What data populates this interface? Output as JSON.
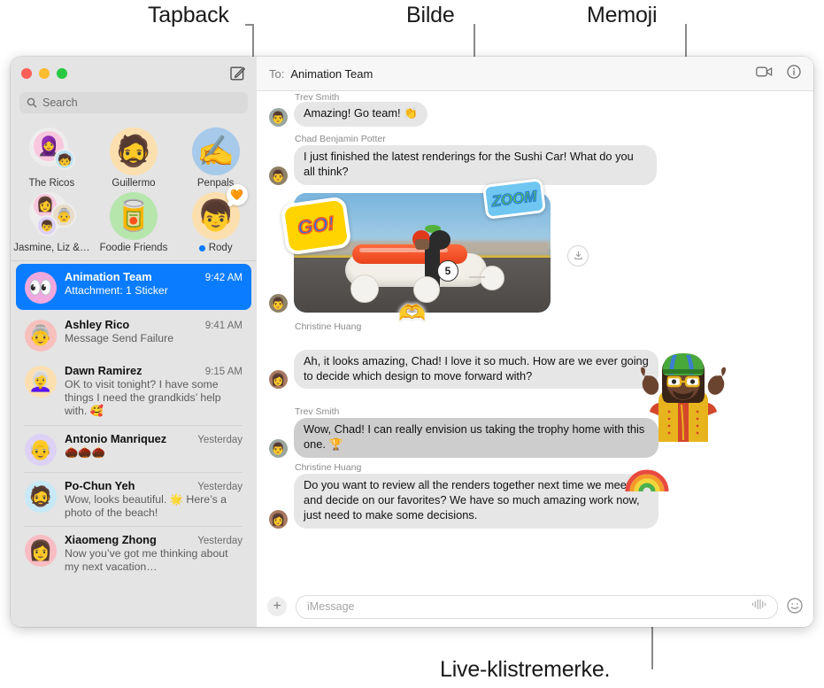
{
  "annotations": [
    {
      "id": "tapback",
      "label": "Tapback"
    },
    {
      "id": "bilde",
      "label": "Bilde"
    },
    {
      "id": "memoji",
      "label": "Memoji"
    },
    {
      "id": "live-sticker",
      "label": "Live-klistremerke."
    }
  ],
  "window": {
    "traffic_lights": {
      "close": "close-button",
      "minimize": "minimize-button",
      "zoom": "zoom-button"
    },
    "compose_icon": "compose-icon"
  },
  "sidebar": {
    "search": {
      "placeholder": "Search",
      "icon": "search-icon"
    },
    "pinned": [
      {
        "name": "The Ricos",
        "type": "group",
        "emoji": "🧕",
        "emoji2": "🧒",
        "bg": "#e6e6e6",
        "badge": "",
        "unread": false
      },
      {
        "name": "Guillermo",
        "type": "single",
        "emoji": "🧔",
        "bg": "#fcdfae",
        "badge": "",
        "unread": false
      },
      {
        "name": "Penpals",
        "type": "single",
        "emoji": "✍️",
        "bg": "#a7c9ea",
        "badge": "",
        "unread": false
      },
      {
        "name": "Jasmine, Liz &…",
        "type": "group",
        "emoji": "👩",
        "emoji2": "👵",
        "emoji3": "👦",
        "bg": "#e6e6e6",
        "badge": "",
        "unread": false
      },
      {
        "name": "Foodie Friends",
        "type": "single",
        "emoji": "🥫",
        "bg": "#b6e6ac",
        "badge": "",
        "unread": false
      },
      {
        "name": "Rody",
        "type": "single",
        "emoji": "👦",
        "bg": "#fcdfae",
        "badge": "🧡",
        "badge_name": "tapback-heart",
        "unread": true
      }
    ],
    "conversations": [
      {
        "name": "Animation Team",
        "time": "9:42 AM",
        "preview": "Attachment: 1 Sticker",
        "selected": true,
        "avatar_emoji": "👀",
        "avatar_bg": "#f0a8de"
      },
      {
        "name": "Ashley Rico",
        "time": "9:41 AM",
        "preview": "Message Send Failure",
        "selected": false,
        "avatar_emoji": "👵",
        "avatar_bg": "#f7c0bc"
      },
      {
        "name": "Dawn Ramirez",
        "time": "9:15 AM",
        "preview": "OK to visit tonight? I have some things I need the grandkids’ help with. 🥰",
        "selected": false,
        "avatar_emoji": "👩‍🦳",
        "avatar_bg": "#fbdfb1"
      },
      {
        "name": "Antonio Manriquez",
        "time": "Yesterday",
        "preview": "🌰🌰🌰",
        "selected": false,
        "avatar_emoji": "👴",
        "avatar_bg": "#ddd2f5"
      },
      {
        "name": "Po-Chun Yeh",
        "time": "Yesterday",
        "preview": "Wow, looks beautiful. 🌟 Here’s a photo of the beach!",
        "selected": false,
        "avatar_emoji": "🧔",
        "avatar_bg": "#c7e9f7"
      },
      {
        "name": "Xiaomeng Zhong",
        "time": "Yesterday",
        "preview": "Now you’ve got me thinking about my next vacation…",
        "selected": false,
        "avatar_emoji": "👩",
        "avatar_bg": "#f9bcc2"
      }
    ]
  },
  "conversation": {
    "to_label": "To:",
    "to_value": "Animation Team",
    "facetime_icon": "video-camera-icon",
    "info_icon": "info-icon",
    "messages": [
      {
        "sender": "Trev Smith",
        "show_sender": true,
        "partial": true,
        "text": "Amazing! Go team! 👏",
        "type": "text",
        "avatar_emoji": "👨",
        "avatar_bg": "#9aa7a0"
      },
      {
        "sender": "Chad Benjamin Potter",
        "show_sender": true,
        "text": "I just finished the latest renderings for the Sushi Car! What do you all think?",
        "type": "text",
        "avatar_emoji": "👨",
        "avatar_bg": "#8f8168"
      },
      {
        "sender": "",
        "show_sender": false,
        "type": "image",
        "alt": "Sushi-shaped soapbox derby car racing on a track",
        "stickers": [
          {
            "name": "go-sticker",
            "text": "GO!",
            "color": "#2f6fe0",
            "bg": "#ffd400"
          },
          {
            "name": "zoom-sticker",
            "text": "ZOOM",
            "color": "#5fd03a",
            "bg": "#6fc6f0"
          },
          {
            "name": "heart-hands-sticker",
            "text": "🫶",
            "color": "",
            "bg": ""
          }
        ],
        "download_icon": "download-icon",
        "avatar_emoji": "👨",
        "avatar_bg": "#8f8168"
      },
      {
        "sender": "Christine Huang",
        "show_sender": true,
        "text": "Ah, it looks amazing, Chad! I love it so much. How are we ever going to decide which design to move forward with?",
        "type": "text",
        "avatar_emoji": "👩",
        "avatar_bg": "#a87a63"
      },
      {
        "sender": "Trev Smith",
        "show_sender": true,
        "text": "Wow, Chad! I can really envision us taking the trophy home with this one. 🏆",
        "type": "text",
        "darker": true,
        "avatar_emoji": "👨",
        "avatar_bg": "#9aa7a0"
      },
      {
        "sender": "Christine Huang",
        "show_sender": true,
        "text": "Do you want to review all the renders together next time we meet and decide on our favorites? We have so much amazing work now, just need to make some decisions.",
        "type": "text",
        "avatar_emoji": "👩",
        "avatar_bg": "#a87a63"
      }
    ],
    "composer": {
      "plus_icon": "add-attachment-icon",
      "placeholder": "iMessage",
      "audio_icon": "audio-waveform-icon",
      "emoji_icon": "emoji-picker-icon"
    }
  },
  "floating": {
    "memoji": {
      "name": "memoji-shrug-character"
    },
    "rainbow_sticker": {
      "name": "rainbow-live-sticker",
      "glyph": "🌈"
    }
  },
  "colors": {
    "accent": "#0a7cff",
    "sidebar_bg": "#e4e4e4",
    "bubble_gray": "#e6e6e6",
    "bubble_gray_dark": "#cdcdcd"
  }
}
